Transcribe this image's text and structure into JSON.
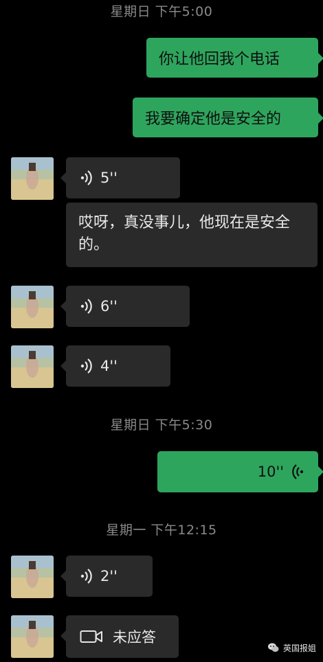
{
  "chat": {
    "timestamps": [
      "星期日 下午5:00",
      "星期日 下午5:30",
      "星期一 下午12:15"
    ],
    "messages": [
      {
        "type": "text",
        "text": "你让他回我个电话"
      },
      {
        "type": "text",
        "text": "我要确定他是安全的"
      },
      {
        "type": "voice",
        "duration": "5''"
      },
      {
        "type": "text",
        "text": "哎呀，真没事儿，他现在是安全的。"
      },
      {
        "type": "voice",
        "duration": "6''"
      },
      {
        "type": "voice",
        "duration": "4''"
      },
      {
        "type": "voice",
        "duration": "10''"
      },
      {
        "type": "voice",
        "duration": "2''"
      },
      {
        "type": "video_call",
        "status": "未应答"
      }
    ]
  },
  "watermark": {
    "text": "英国报姐"
  },
  "colors": {
    "outgoing_bubble": "#2ea55d",
    "incoming_bubble": "#2a2a2a",
    "background": "#000000",
    "timestamp": "#8a8a8a"
  },
  "icons": [
    "voice-wave-icon",
    "video-call-icon",
    "wechat-logo-icon"
  ]
}
